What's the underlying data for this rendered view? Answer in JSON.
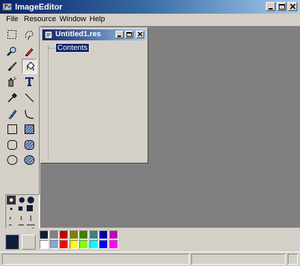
{
  "window": {
    "title": "ImageEditor",
    "icon": "image-editor-icon",
    "controls": [
      "minimize-icon",
      "maximize-icon",
      "close-icon"
    ]
  },
  "menu": {
    "items": [
      {
        "label": "File"
      },
      {
        "label": "Resource"
      },
      {
        "label": "Window"
      },
      {
        "label": "Help"
      }
    ]
  },
  "toolbox": {
    "tools": [
      {
        "name": "rectangle-select-tool",
        "icon": "dashed-rectangle-icon"
      },
      {
        "name": "freeform-select-tool",
        "icon": "lasso-icon"
      },
      {
        "name": "zoom-tool",
        "icon": "magnifier-icon"
      },
      {
        "name": "pencil-tool",
        "icon": "pencil-icon"
      },
      {
        "name": "brush-tool",
        "icon": "brush-icon"
      },
      {
        "name": "fill-tool",
        "icon": "fill-bucket-icon"
      },
      {
        "name": "airbrush-tool",
        "icon": "spray-can-icon"
      },
      {
        "name": "text-tool",
        "icon": "text-t-icon"
      },
      {
        "name": "eyedropper-tool",
        "icon": "eyedropper-icon"
      },
      {
        "name": "line-tool",
        "icon": "line-icon"
      },
      {
        "name": "eraser-tool",
        "icon": "eraser-icon"
      },
      {
        "name": "curve-tool",
        "icon": "curve-icon"
      },
      {
        "name": "rectangle-tool",
        "icon": "rectangle-icon"
      },
      {
        "name": "filled-rectangle-tool",
        "icon": "filled-rectangle-icon"
      },
      {
        "name": "rounded-rectangle-tool",
        "icon": "rounded-rectangle-icon"
      },
      {
        "name": "filled-rounded-rectangle-tool",
        "icon": "filled-rounded-rectangle-icon"
      },
      {
        "name": "ellipse-tool",
        "icon": "ellipse-icon"
      },
      {
        "name": "filled-ellipse-tool",
        "icon": "filled-ellipse-icon"
      }
    ],
    "selected_tool": "fill-tool"
  },
  "child_window": {
    "title": "Untitled1.res",
    "icon": "resource-file-icon",
    "tree": {
      "items": [
        {
          "label": "Contents",
          "selected": true
        }
      ]
    }
  },
  "palette": {
    "foreground": "#0F1C3C",
    "background": "#D4D0C8",
    "colors_top": [
      "#0F1C3C",
      "#808080",
      "#C00000",
      "#808000",
      "#408000",
      "#408080",
      "#0000A0",
      "#C000C0"
    ],
    "colors_bottom": [
      "#FFFFFF",
      "#80A8E0",
      "#FF0000",
      "#FFFF00",
      "#80FF00",
      "#00FFFF",
      "#0000FF",
      "#FF00FF"
    ]
  },
  "status": {
    "panes": [
      "",
      "",
      ""
    ]
  }
}
